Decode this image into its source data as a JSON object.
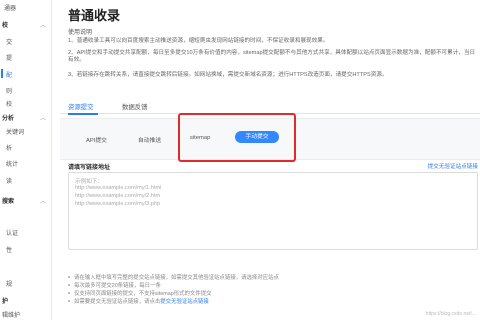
{
  "sidebar": {
    "items": [
      {
        "label": "通器",
        "kind": "item"
      },
      {
        "label": "校",
        "kind": "group"
      },
      {
        "label": "交",
        "kind": "item"
      },
      {
        "label": "提",
        "kind": "item"
      },
      {
        "label": "配",
        "kind": "item",
        "active": true
      },
      {
        "label": "则",
        "kind": "item"
      },
      {
        "label": "校",
        "kind": "item"
      },
      {
        "label": "分析",
        "kind": "group"
      },
      {
        "label": "关键词",
        "kind": "item"
      },
      {
        "label": "析",
        "kind": "item"
      },
      {
        "label": "统计",
        "kind": "item"
      },
      {
        "label": "读",
        "kind": "item"
      },
      {
        "label": "搜索",
        "kind": "group"
      },
      {
        "label": "认证",
        "kind": "item"
      },
      {
        "label": "性",
        "kind": "item"
      },
      {
        "label": "",
        "kind": "item"
      },
      {
        "label": "规",
        "kind": "item"
      },
      {
        "label": "护",
        "kind": "group"
      },
      {
        "label": "辑维护",
        "kind": "item"
      }
    ]
  },
  "page": {
    "title": "普通收录",
    "section_title": "使用说明",
    "desc_lines": [
      "1、普通收录工具可以向百度搜索主动推送资源，缩短爬虫发现网站链接的时间，不保证收录和展现效果。",
      "2、API提交和手动提交共享配额，每日至多提交10万条有价值的内容，sitemap提交配额不与其他方式共享，具体配额以站点页面显示数据为准，配额不可累计，当日有效。",
      "3、若链接存在跳转关系，请直接提交跳转后链接。如网站换域，需提交新域名资源；进行HTTPS改造页面，请提交HTTPS资源。"
    ]
  },
  "tabs": [
    {
      "label": "资源提交",
      "active": true
    },
    {
      "label": "数据反馈",
      "active": false
    }
  ],
  "methods": [
    {
      "label": "API提交"
    },
    {
      "label": "自动推送"
    },
    {
      "label": "sitemap"
    },
    {
      "label": "手动提交",
      "selected": true
    }
  ],
  "url_input": {
    "label": "请填写链接地址",
    "verify_link": "提交无验证站点链接",
    "placeholder_lines": [
      "示例如下：",
      "http://www.example.com/my/1.html",
      "http://www.example.com/my/2.htm",
      "http://www.example.com/my/3.php"
    ]
  },
  "notes": [
    {
      "text": "请在输入框中填写完整的提交站点链接，如需提交其他验证站点链接，请选择对应站点"
    },
    {
      "text": "每次最多可提交20条链接，每日一条"
    },
    {
      "text": "仅支持同页面链接的提交，不支持sitemap形式的文件提交"
    },
    {
      "text": "如需要提交无验证站点链接，请点击",
      "link": "提交无验证站点链接"
    }
  ],
  "watermark": "https://blog.csdn.net/..."
}
